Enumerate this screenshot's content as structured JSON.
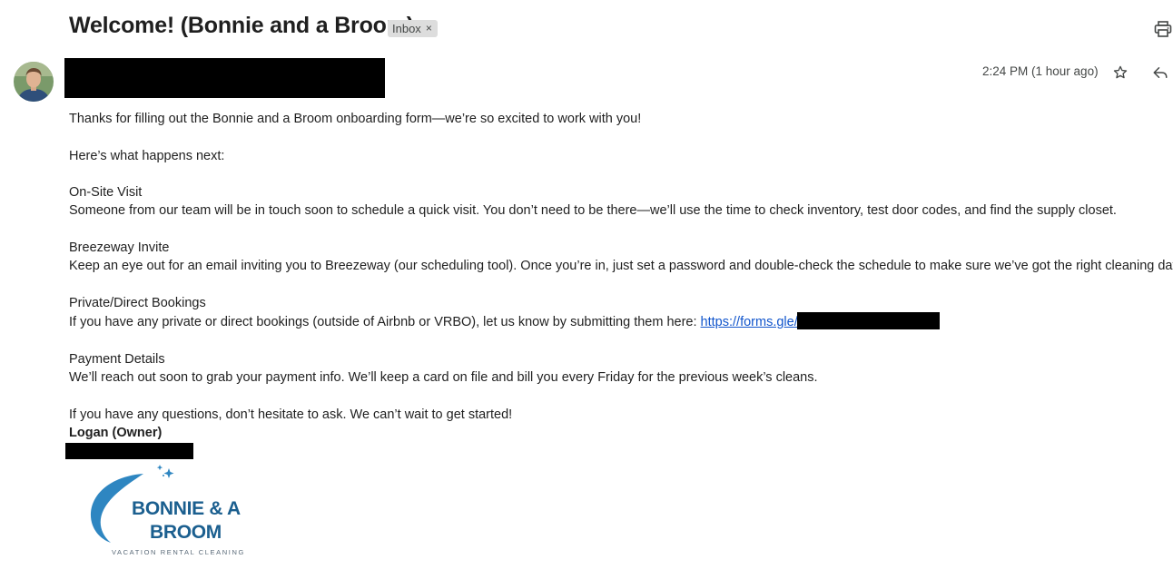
{
  "header": {
    "subject": "Welcome! (Bonnie and a Broom)",
    "label": "Inbox",
    "label_remove": "×"
  },
  "message": {
    "timestamp": "2:24 PM (1 hour ago)"
  },
  "body": {
    "intro": "Thanks for filling out the Bonnie and a Broom onboarding form—we’re so excited to work with you!",
    "next": "Here’s what happens next:",
    "section1_title": "On-Site Visit",
    "section1_text": "Someone from our team will be in touch soon to schedule a quick visit. You don’t need to be there—we’ll use the time to check inventory, test door codes, and find the supply closet.",
    "section2_title": "Breezeway Invite",
    "section2_text": "Keep an eye out for an email inviting you to Breezeway (our scheduling tool). Once you’re in, just set a password and double-check the schedule to make sure we’ve got the right cleaning dates.",
    "section3_title": "Private/Direct Bookings",
    "section3_text": "If you have any private or direct bookings (outside of Airbnb or VRBO), let us know by submitting them here: ",
    "section3_link": "https://forms.gle/",
    "section4_title": "Payment Details",
    "section4_text": "We’ll reach out soon to grab your payment info. We’ll keep a card on file and bill you every Friday for the previous week’s cleans.",
    "closing": "If you have any questions, don’t hesitate to ask. We can’t wait to get started!",
    "signature_name": "Logan (Owner)"
  },
  "logo": {
    "line1": "BONNIE & A",
    "line2": "BROOM",
    "tagline": "VACATION RENTAL CLEANING",
    "brand_color": "#1b5f8f",
    "accent_color": "#2e86c1"
  },
  "icons": {
    "print": "print-icon",
    "star": "star-icon",
    "reply": "reply-icon",
    "avatar": "avatar"
  }
}
